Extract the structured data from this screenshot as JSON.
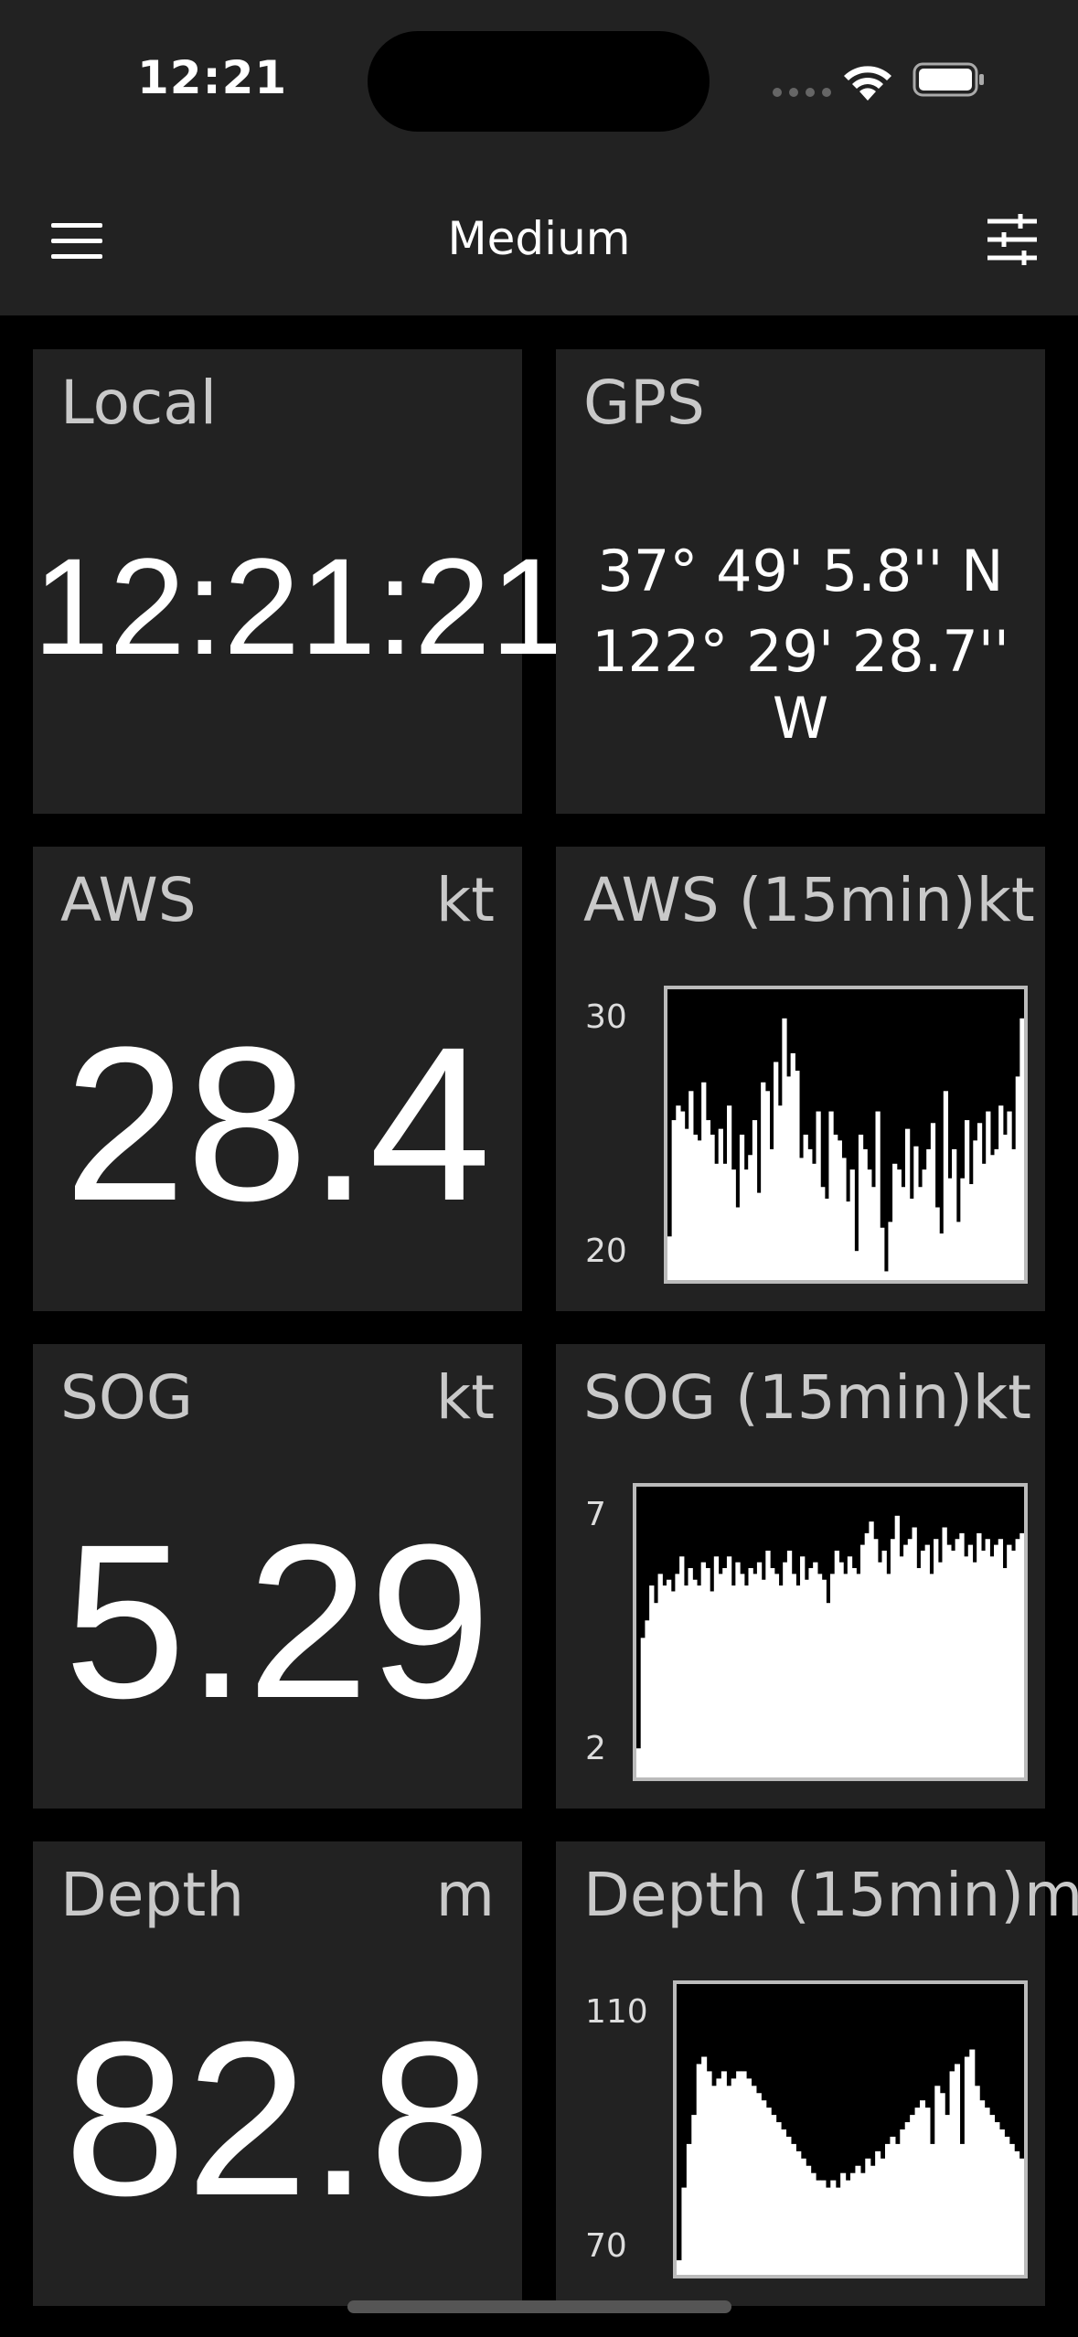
{
  "status": {
    "time": "12:21"
  },
  "nav": {
    "title": "Medium"
  },
  "tiles": {
    "local": {
      "label": "Local",
      "value": "12:21:21"
    },
    "gps": {
      "label": "GPS",
      "lat": "37° 49' 5.8'' N",
      "lon": "122° 29' 28.7'' W"
    },
    "aws": {
      "label": "AWS",
      "unit": "kt",
      "value": "28.4"
    },
    "aws_chart": {
      "label": "AWS (15min)kt",
      "ymax": "30",
      "ymin": "20"
    },
    "sog": {
      "label": "SOG",
      "unit": "kt",
      "value": "5.29"
    },
    "sog_chart": {
      "label": "SOG (15min)kt",
      "ymax": "7",
      "ymin": "2"
    },
    "depth": {
      "label": "Depth",
      "unit": "m",
      "value": "82.8"
    },
    "depth_chart": {
      "label": "Depth (15min)m",
      "ymax": "110",
      "ymin": "70"
    }
  },
  "chart_data": [
    {
      "type": "area",
      "title": "AWS (15min)kt",
      "ylim": [
        20,
        30
      ],
      "values": [
        21.5,
        25.5,
        26,
        25.8,
        25.2,
        26.5,
        25,
        24.8,
        26.8,
        25.5,
        25,
        24,
        25.2,
        24,
        26,
        23.8,
        22.5,
        25,
        23.8,
        24.3,
        25.5,
        23,
        26.8,
        26.5,
        24.5,
        27.5,
        26,
        29,
        27,
        27.8,
        27.2,
        24.2,
        25,
        24.5,
        24,
        25.8,
        23.2,
        22.8,
        25.8,
        25,
        24.8,
        24.2,
        22.7,
        23.8,
        21,
        25,
        24.5,
        23.8,
        23.2,
        25.8,
        21.8,
        20.3,
        22,
        24,
        23.8,
        23.2,
        25.2,
        22.8,
        24.6,
        23.2,
        23.8,
        24.5,
        25.4,
        22.5,
        21.6,
        26.5,
        23.5,
        24.5,
        22,
        23.5,
        25.5,
        23.3,
        24.8,
        25.4,
        24,
        25.8,
        24.3,
        24.5,
        26,
        25,
        25.8,
        24.5,
        27,
        29
      ]
    },
    {
      "type": "area",
      "title": "SOG (15min)kt",
      "ylim": [
        2,
        7
      ],
      "values": [
        2.5,
        4.4,
        4.7,
        5.3,
        5.0,
        5.5,
        5.3,
        5.4,
        5.2,
        5.5,
        5.8,
        5.3,
        5.6,
        5.4,
        5.3,
        5.7,
        5.6,
        5.2,
        5.8,
        5.5,
        5.6,
        5.8,
        5.3,
        5.7,
        5.5,
        5.3,
        5.6,
        5.5,
        5.7,
        5.4,
        5.9,
        5.6,
        5.5,
        5.3,
        5.7,
        5.9,
        5.5,
        5.3,
        5.8,
        5.4,
        5.6,
        5.7,
        5.5,
        5.4,
        5.0,
        5.5,
        5.9,
        5.7,
        5.5,
        5.8,
        5.6,
        5.5,
        6.0,
        6.2,
        6.4,
        6.1,
        5.7,
        5.9,
        5.5,
        6.1,
        6.5,
        5.8,
        6.0,
        6.1,
        6.3,
        5.6,
        5.9,
        6.0,
        5.5,
        6.1,
        5.7,
        6.3,
        6.0,
        5.9,
        6.1,
        6.2,
        5.8,
        6.0,
        5.7,
        6.2,
        5.9,
        6.1,
        5.8,
        6.0,
        6.1,
        5.6,
        6.0,
        5.9,
        6.1,
        6.2
      ]
    },
    {
      "type": "area",
      "title": "Depth (15min)m",
      "ylim": [
        70,
        110
      ],
      "values": [
        72,
        82,
        88,
        92,
        99,
        100,
        98,
        96,
        97,
        98,
        96,
        97,
        98,
        98,
        97,
        96,
        95,
        94,
        93,
        92,
        91,
        90,
        89,
        88,
        87,
        86,
        85,
        84,
        83,
        83,
        82,
        83,
        82,
        84,
        83,
        84,
        85,
        84,
        86,
        85,
        87,
        86,
        88,
        89,
        88,
        90,
        91,
        92,
        93,
        94,
        93,
        88,
        96,
        95,
        92,
        98,
        99,
        88,
        100,
        101,
        96,
        94,
        93,
        92,
        91,
        90,
        89,
        88,
        87,
        86
      ]
    }
  ]
}
